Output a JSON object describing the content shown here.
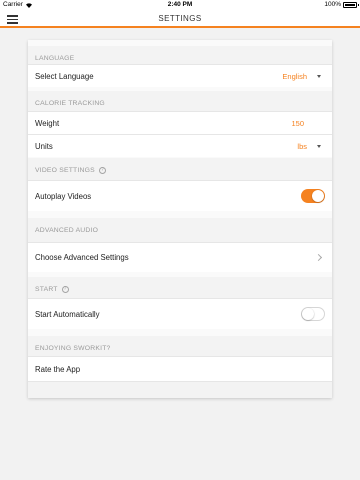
{
  "status_bar": {
    "carrier": "Carrier",
    "wifi_icon": "wifi-icon",
    "time": "2:40 PM",
    "battery_percent": "100%",
    "battery_level": 1.0
  },
  "navbar": {
    "title": "SETTINGS",
    "menu_icon": "hamburger-icon",
    "accent_color": "#f58220"
  },
  "sections": {
    "language": {
      "header": "LANGUAGE",
      "select_language": {
        "label": "Select Language",
        "value": "English"
      }
    },
    "calorie_tracking": {
      "header": "CALORIE TRACKING",
      "weight": {
        "label": "Weight",
        "value": "150"
      },
      "units": {
        "label": "Units",
        "value": "lbs"
      }
    },
    "video_settings": {
      "header": "VIDEO SETTINGS",
      "autoplay": {
        "label": "Autoplay Videos",
        "enabled": true
      }
    },
    "advanced_audio": {
      "header": "ADVANCED AUDIO",
      "choose": {
        "label": "Choose Advanced Settings"
      }
    },
    "start": {
      "header": "START",
      "start_auto": {
        "label": "Start Automatically",
        "enabled": false
      }
    },
    "enjoying": {
      "header": "ENJOYING SWORKIT?",
      "rate": {
        "label": "Rate the App"
      }
    }
  }
}
